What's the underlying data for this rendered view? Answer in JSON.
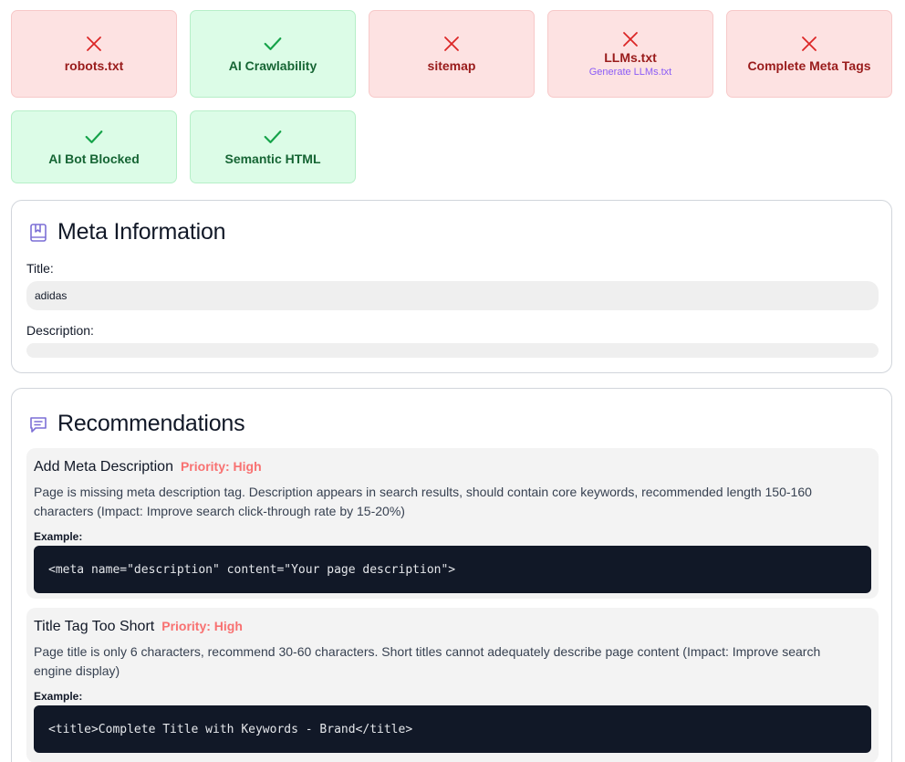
{
  "checks": [
    {
      "label": "robots.txt",
      "status": "fail"
    },
    {
      "label": "AI Crawlability",
      "status": "pass"
    },
    {
      "label": "sitemap",
      "status": "fail"
    },
    {
      "label": "LLMs.txt",
      "status": "fail",
      "link": "Generate LLMs.txt"
    },
    {
      "label": "Complete Meta Tags",
      "status": "fail"
    },
    {
      "label": "AI Bot Blocked",
      "status": "pass"
    },
    {
      "label": "Semantic HTML",
      "status": "pass"
    }
  ],
  "meta": {
    "heading": "Meta Information",
    "title_label": "Title:",
    "title_value": "adidas",
    "description_label": "Description:",
    "description_value": ""
  },
  "recommendations": {
    "heading": "Recommendations",
    "items": [
      {
        "title": "Add Meta Description",
        "priority": "Priority: High",
        "description": "Page is missing meta description tag. Description appears in search results, should contain core keywords, recommended length 150-160 characters (Impact: Improve search click-through rate by 15-20%)",
        "example_label": "Example:",
        "code": "<meta name=\"description\" content=\"Your page description\">"
      },
      {
        "title": "Title Tag Too Short",
        "priority": "Priority: High",
        "description": "Page title is only 6 characters, recommend 30-60 characters. Short titles cannot adequately describe page content (Impact: Improve search engine display)",
        "example_label": "Example:",
        "code": "<title>Complete Title with Keywords - Brand</title>"
      }
    ]
  },
  "colors": {
    "fail_bg": "#fde2e2",
    "fail_text": "#991b1b",
    "pass_bg": "#dcfce7",
    "pass_text": "#166534",
    "priority_high": "#f87171",
    "accent_purple": "#8b5cf6",
    "code_bg": "#111827"
  },
  "icons": {
    "fail": "x-icon",
    "pass": "check-icon",
    "meta": "bookmark-book-icon",
    "recommendations": "message-square-icon"
  }
}
